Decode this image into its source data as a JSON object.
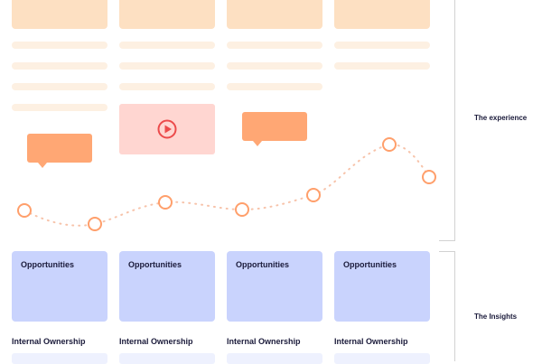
{
  "sections": {
    "experience": "The experience",
    "insights": "The Insights"
  },
  "insight_cards": [
    {
      "label": "Opportunities"
    },
    {
      "label": "Opportunities"
    },
    {
      "label": "Opportunities"
    },
    {
      "label": "Opportunities"
    }
  ],
  "ownership_labels": [
    "Internal Ownership",
    "Internal Ownership",
    "Internal Ownership",
    "Internal Ownership"
  ],
  "icons": {
    "video": "play-icon"
  },
  "colors": {
    "header_card": "#fde0c2",
    "placeholder_line": "#fdf0e2",
    "bubble": "#ffa774",
    "video_card": "#ffd6d1",
    "journey_point": "#ff9f6b",
    "insight_card": "#c9d3fd",
    "label_text": "#1a1a3a",
    "bracket": "#d2d2d2"
  }
}
